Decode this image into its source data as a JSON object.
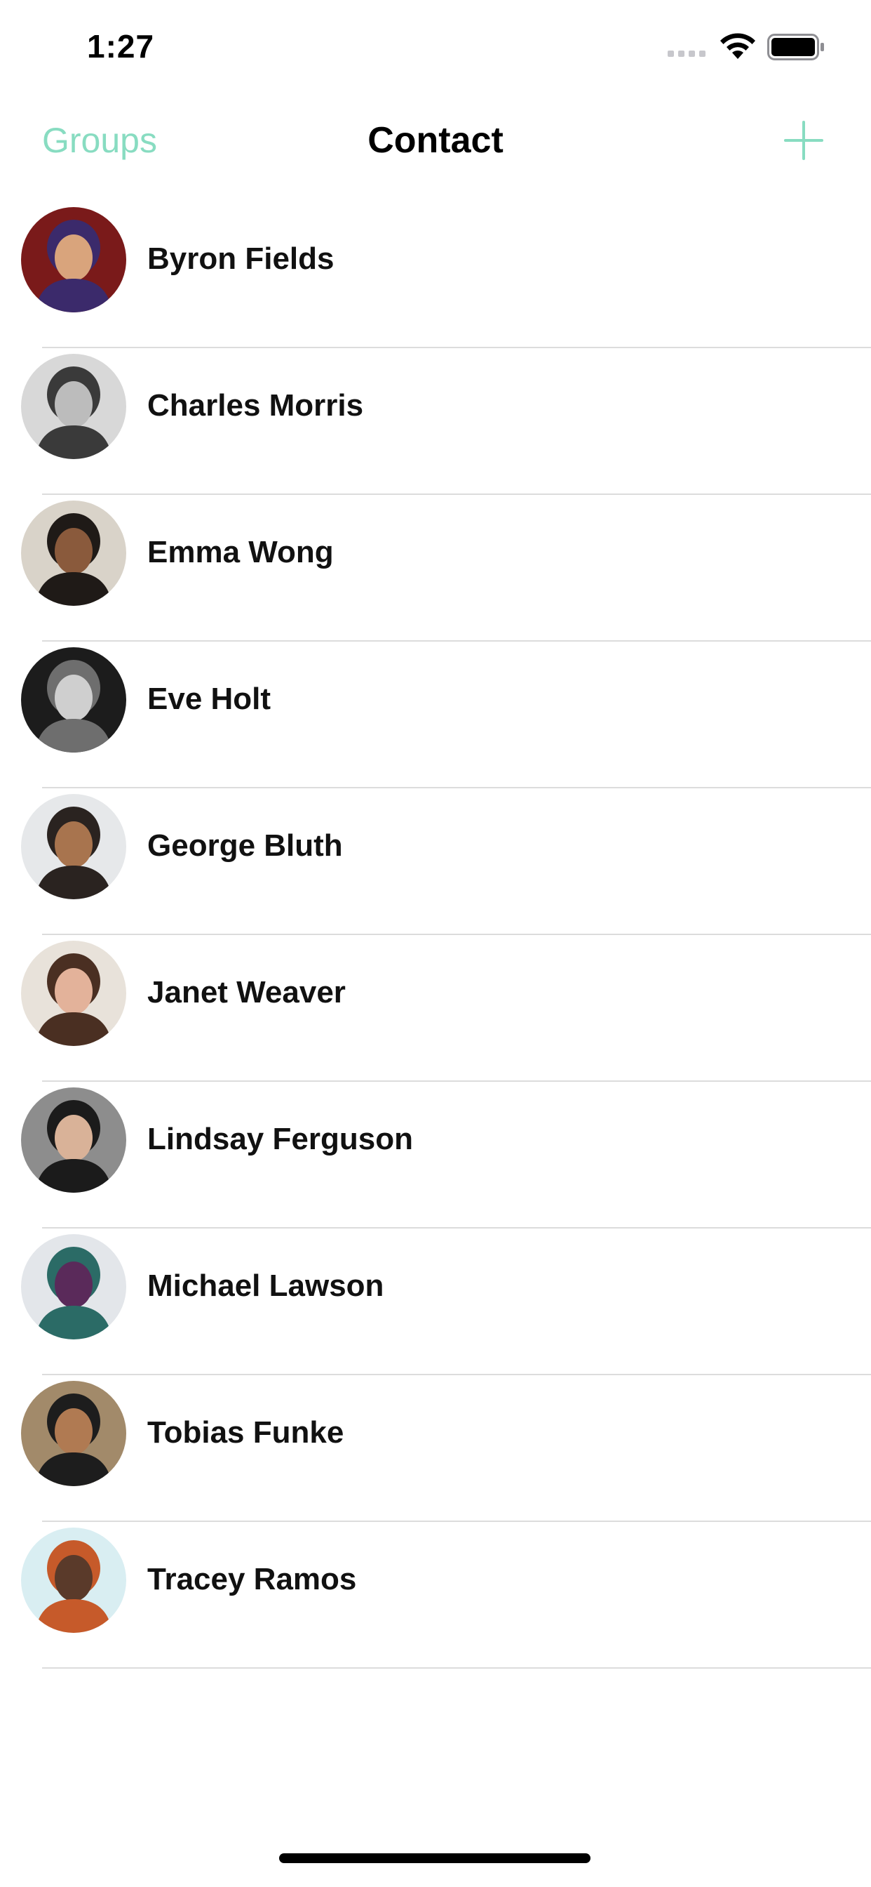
{
  "status_bar": {
    "time": "1:27",
    "signal_icon": "cellular-signal-icon",
    "wifi_icon": "wifi-icon",
    "battery_icon": "battery-icon"
  },
  "nav": {
    "left_label": "Groups",
    "title": "Contact",
    "add_icon": "plus-icon",
    "accent_color": "#88dcc1"
  },
  "contacts": [
    {
      "name": "Byron Fields",
      "avatar_colors": [
        "#7a1a1a",
        "#d9a47c",
        "#3b2a6b"
      ]
    },
    {
      "name": "Charles Morris",
      "avatar_colors": [
        "#d8d8d8",
        "#bcbcbc",
        "#3a3a3a"
      ]
    },
    {
      "name": "Emma Wong",
      "avatar_colors": [
        "#d9d3c9",
        "#8a5a3c",
        "#1f1a17"
      ]
    },
    {
      "name": "Eve Holt",
      "avatar_colors": [
        "#1c1c1c",
        "#cfcfcf",
        "#6e6e6e"
      ]
    },
    {
      "name": "George Bluth",
      "avatar_colors": [
        "#e6e8ea",
        "#a8744e",
        "#2a2320"
      ]
    },
    {
      "name": "Janet Weaver",
      "avatar_colors": [
        "#e8e2da",
        "#e3b29a",
        "#4a2f22"
      ]
    },
    {
      "name": "Lindsay Ferguson",
      "avatar_colors": [
        "#8d8d8d",
        "#d9b298",
        "#1b1b1b"
      ]
    },
    {
      "name": "Michael Lawson",
      "avatar_colors": [
        "#e3e6ea",
        "#5a2a5a",
        "#2b6b66"
      ]
    },
    {
      "name": "Tobias Funke",
      "avatar_colors": [
        "#a28a6a",
        "#b07a52",
        "#1d1d1d"
      ]
    },
    {
      "name": "Tracey Ramos",
      "avatar_colors": [
        "#d9eef2",
        "#5a3a2a",
        "#c65a2a"
      ]
    }
  ]
}
